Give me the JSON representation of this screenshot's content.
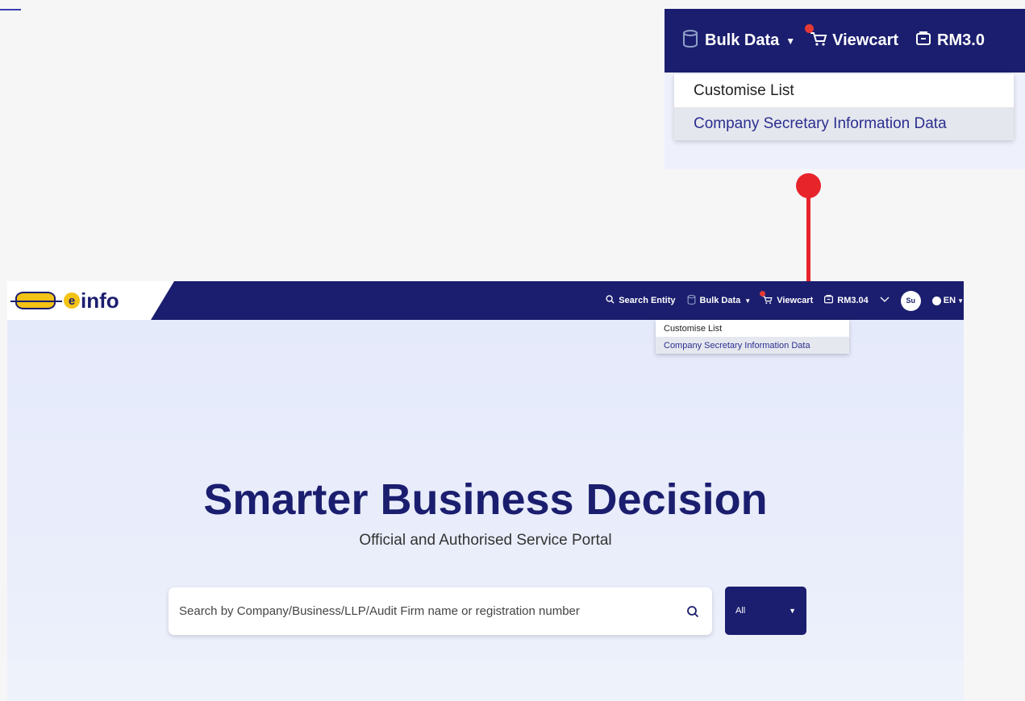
{
  "zoom": {
    "bulk_data": "Bulk Data",
    "viewcart": "Viewcart",
    "balance": "RM3.0",
    "menu": [
      "Customise List",
      "Company Secretary Information Data"
    ]
  },
  "nav": {
    "logo_ssm": "SSM",
    "logo_einfo": "info",
    "logo_e": "e",
    "search_entity": "Search Entity",
    "bulk_data": "Bulk Data",
    "viewcart": "Viewcart",
    "balance": "RM3.04",
    "avatar": "Su",
    "language": "EN"
  },
  "dropdown": {
    "items": [
      "Customise List",
      "Company Secretary Information Data"
    ]
  },
  "hero": {
    "title": "Smarter Business Decision",
    "subtitle": "Official and Authorised Service Portal"
  },
  "search": {
    "placeholder": "Search by Company/Business/LLP/Audit Firm name or registration number",
    "filter_value": "All"
  },
  "colors": {
    "navy": "#1b1e6e",
    "accent_red": "#e8242b",
    "logo_yellow": "#f3c316"
  }
}
